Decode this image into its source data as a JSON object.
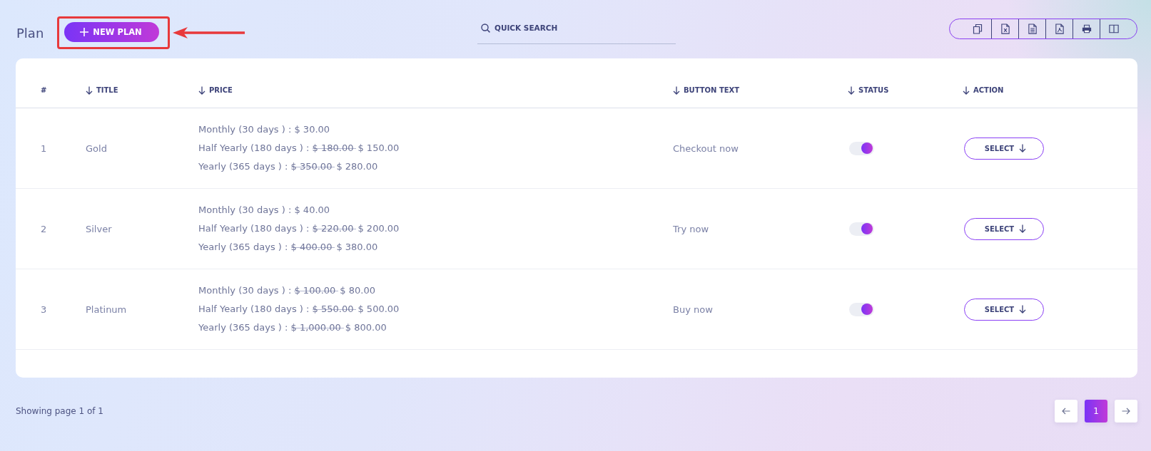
{
  "page": {
    "title": "Plan",
    "new_button": {
      "label": "NEW PLAN"
    },
    "search": {
      "placeholder": "QUICK SEARCH"
    },
    "export_buttons": [
      {
        "kind": "copy"
      },
      {
        "kind": "excel"
      },
      {
        "kind": "csv"
      },
      {
        "kind": "pdf"
      },
      {
        "kind": "print"
      },
      {
        "kind": "columns"
      }
    ]
  },
  "table": {
    "columns": [
      {
        "label": "#",
        "sortable": false
      },
      {
        "label": "TITLE",
        "sortable": true
      },
      {
        "label": "PRICE",
        "sortable": true
      },
      {
        "label": "BUTTON TEXT",
        "sortable": true
      },
      {
        "label": "STATUS",
        "sortable": true
      },
      {
        "label": "ACTION",
        "sortable": true
      }
    ],
    "rows": [
      {
        "number": "1",
        "title": "Gold",
        "prices": [
          {
            "label": "Monthly (30 days ) :",
            "price": "$ 30.00"
          },
          {
            "label": "Half Yearly (180 days ) :",
            "old_price": "$ 180.00",
            "price": "$ 150.00"
          },
          {
            "label": "Yearly (365 days ) :",
            "old_price": "$ 350.00",
            "price": "$ 280.00"
          }
        ],
        "button_text": "Checkout now",
        "status_on": true,
        "action": "SELECT"
      },
      {
        "number": "2",
        "title": "Silver",
        "prices": [
          {
            "label": "Monthly (30 days ) :",
            "price": "$ 40.00"
          },
          {
            "label": "Half Yearly (180 days ) :",
            "old_price": "$ 220.00",
            "price": "$ 200.00"
          },
          {
            "label": "Yearly (365 days ) :",
            "old_price": "$ 400.00",
            "price": "$ 380.00"
          }
        ],
        "button_text": "Try now",
        "status_on": true,
        "action": "SELECT"
      },
      {
        "number": "3",
        "title": "Platinum",
        "prices": [
          {
            "label": "Monthly (30 days ) :",
            "old_price": "$ 100.00",
            "price": "$ 80.00"
          },
          {
            "label": "Half Yearly (180 days ) :",
            "old_price": "$ 550.00",
            "price": "$ 500.00"
          },
          {
            "label": "Yearly (365 days ) :",
            "old_price": "$ 1,000.00",
            "price": "$ 800.00"
          }
        ],
        "button_text": "Buy now",
        "status_on": true,
        "action": "SELECT"
      }
    ]
  },
  "footer": {
    "summary": "Showing page 1 of 1",
    "pages": [
      {
        "label": "1",
        "selected": true
      }
    ]
  }
}
